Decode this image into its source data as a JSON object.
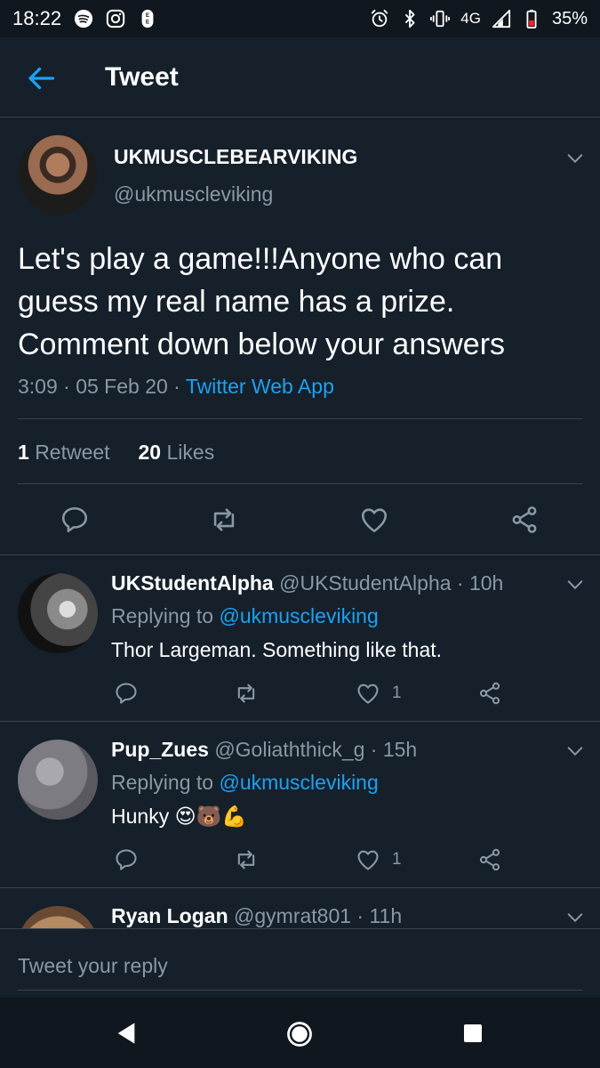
{
  "status_bar": {
    "time": "18:22",
    "network": "4G",
    "battery": "35%",
    "left_icons": [
      "spotify-icon",
      "instagram-icon",
      "ee-icon"
    ],
    "right_icons": [
      "alarm-icon",
      "bluetooth-icon",
      "vibrate-icon",
      "signal-icon",
      "battery-icon"
    ]
  },
  "header": {
    "title": "Tweet"
  },
  "tweet": {
    "display_name": "UKMUSCLEBEARVIKING",
    "handle": "@ukmuscleviking",
    "text": "Let's play a game!!!Anyone who can guess my real name has a prize. Comment down below your answers",
    "time": "3:09 · 05 Feb 20 · ",
    "source": "Twitter Web App",
    "retweet_count": "1",
    "retweet_label": "Retweet",
    "like_count": "20",
    "like_label": "Likes"
  },
  "replies": [
    {
      "name": "UKStudentAlpha",
      "handle": "@UKStudentAlpha · 10h",
      "replying_label": "Replying to ",
      "replying_to": "@ukmuscleviking",
      "text": "Thor Largeman. Something like that.",
      "like_count": "1"
    },
    {
      "name": "Pup_Zues",
      "handle": "@Goliaththick_g · 15h",
      "replying_label": "Replying to ",
      "replying_to": "@ukmuscleviking",
      "text": "Hunky ",
      "emoji": "😍🐻💪",
      "like_count": "1"
    },
    {
      "name": "Ryan Logan",
      "handle": "@gymrat801 · 11h"
    }
  ],
  "composer": {
    "placeholder": "Tweet your reply"
  },
  "colors": {
    "background": "#15202b",
    "accent": "#1da1f2",
    "muted": "#8899a6",
    "divider": "#38444d"
  }
}
